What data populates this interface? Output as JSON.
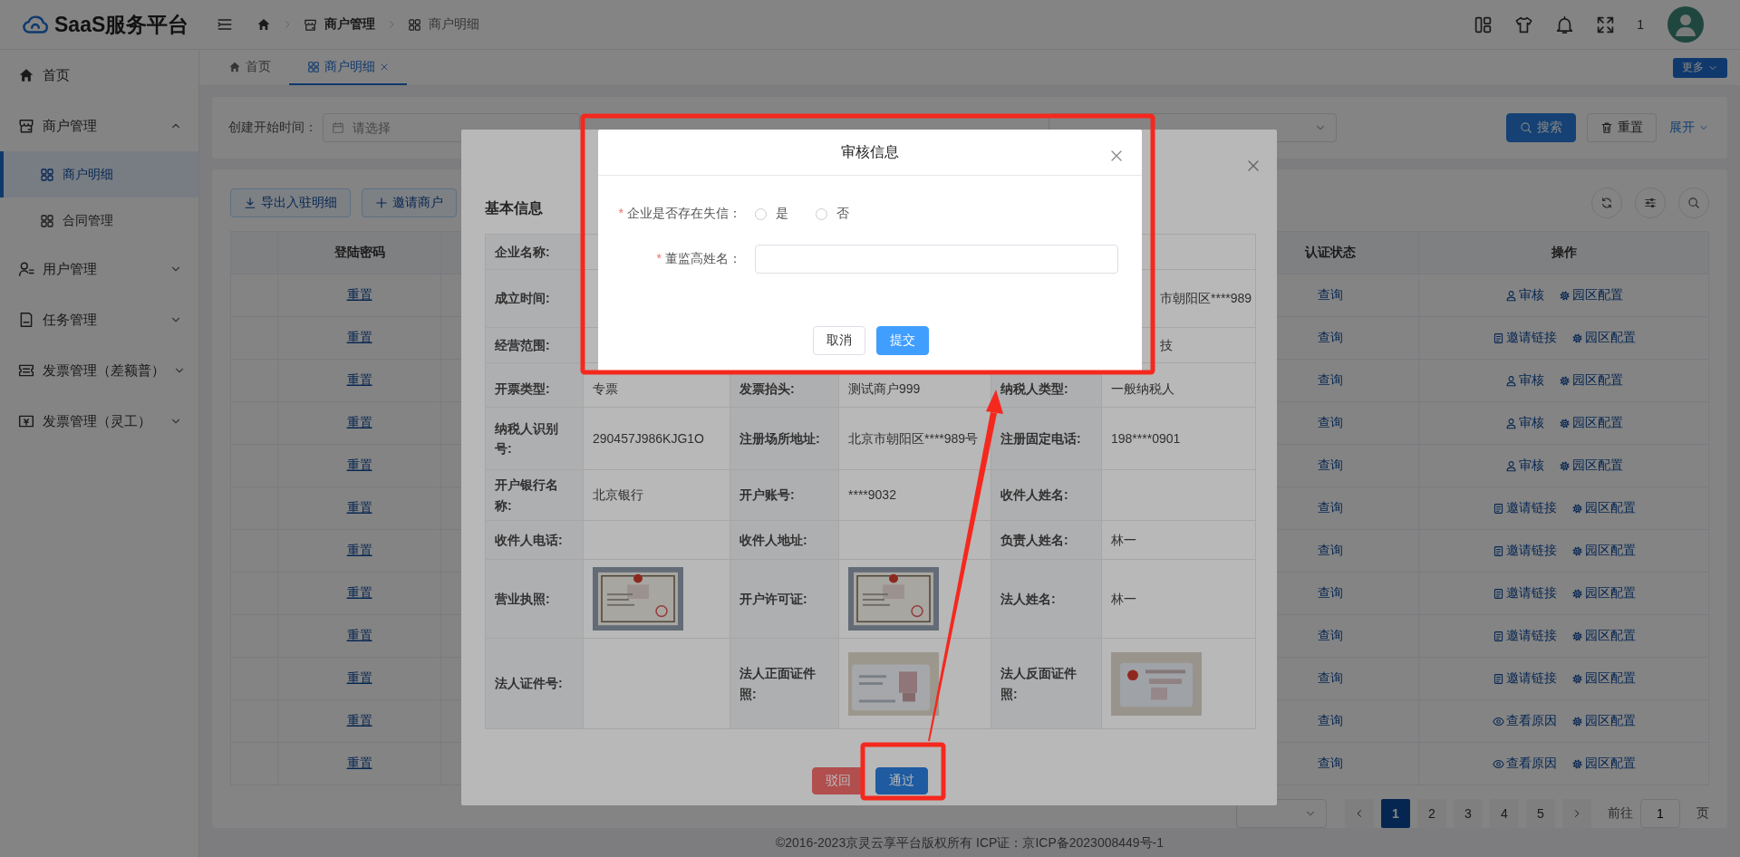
{
  "header": {
    "logo": "SaaS服务平台",
    "breadcrumb": [
      {
        "label": "商户管理"
      },
      {
        "label": "商户明细"
      }
    ],
    "user_badge": "1"
  },
  "sidebar": {
    "items": [
      {
        "label": "首页",
        "selected": false
      },
      {
        "label": "商户管理",
        "selected": false,
        "expanded": true,
        "children": [
          {
            "label": "商户明细",
            "selected": true
          },
          {
            "label": "合同管理",
            "selected": false
          }
        ]
      },
      {
        "label": "用户管理",
        "selected": false,
        "expanded": false
      },
      {
        "label": "任务管理",
        "selected": false,
        "expanded": false
      },
      {
        "label": "发票管理（差额普）",
        "selected": false,
        "expanded": false
      },
      {
        "label": "发票管理（灵工）",
        "selected": false,
        "expanded": false
      }
    ]
  },
  "tabs": [
    {
      "label": "首页",
      "selected": false,
      "closable": false
    },
    {
      "label": "商户明细",
      "selected": true,
      "closable": true
    }
  ],
  "more_button": "更多",
  "filter": {
    "label": "创建开始时间：",
    "placeholder": "请选择",
    "search_button": "搜索",
    "reset_button": "重置",
    "expand_link": "展开"
  },
  "toolbar": [
    "导出入驻明细",
    "邀请商户"
  ],
  "table": {
    "columns": [
      {
        "label": "登陆密码"
      },
      {
        "label": "认证状态"
      },
      {
        "label": "操作"
      }
    ],
    "rows": [
      {
        "password": "重置",
        "status": "查询",
        "actions": [
          {
            "kind": "audit",
            "label": "审核"
          },
          {
            "kind": "settings",
            "label": "园区配置"
          }
        ]
      },
      {
        "password": "重置",
        "status": "查询",
        "actions": [
          {
            "kind": "invite",
            "label": "邀请链接"
          },
          {
            "kind": "settings",
            "label": "园区配置"
          }
        ]
      },
      {
        "password": "重置",
        "status": "查询",
        "actions": [
          {
            "kind": "audit",
            "label": "审核"
          },
          {
            "kind": "settings",
            "label": "园区配置"
          }
        ]
      },
      {
        "password": "重置",
        "status": "查询",
        "actions": [
          {
            "kind": "audit",
            "label": "审核"
          },
          {
            "kind": "settings",
            "label": "园区配置"
          }
        ]
      },
      {
        "password": "重置",
        "status": "查询",
        "actions": [
          {
            "kind": "audit",
            "label": "审核"
          },
          {
            "kind": "settings",
            "label": "园区配置"
          }
        ]
      },
      {
        "password": "重置",
        "status": "查询",
        "actions": [
          {
            "kind": "invite",
            "label": "邀请链接"
          },
          {
            "kind": "settings",
            "label": "园区配置"
          }
        ]
      },
      {
        "password": "重置",
        "status": "查询",
        "actions": [
          {
            "kind": "invite",
            "label": "邀请链接"
          },
          {
            "kind": "settings",
            "label": "园区配置"
          }
        ]
      },
      {
        "password": "重置",
        "status": "查询",
        "actions": [
          {
            "kind": "invite",
            "label": "邀请链接"
          },
          {
            "kind": "settings",
            "label": "园区配置"
          }
        ]
      },
      {
        "password": "重置",
        "status": "查询",
        "actions": [
          {
            "kind": "invite",
            "label": "邀请链接"
          },
          {
            "kind": "settings",
            "label": "园区配置"
          }
        ]
      },
      {
        "password": "重置",
        "status": "查询",
        "actions": [
          {
            "kind": "invite",
            "label": "邀请链接"
          },
          {
            "kind": "settings",
            "label": "园区配置"
          }
        ]
      },
      {
        "password": "重置",
        "status": "查询",
        "actions": [
          {
            "kind": "reason",
            "label": "查看原因"
          },
          {
            "kind": "settings",
            "label": "园区配置"
          }
        ]
      },
      {
        "password": "重置",
        "status": "查询",
        "actions": [
          {
            "kind": "reason",
            "label": "查看原因"
          },
          {
            "kind": "settings",
            "label": "园区配置"
          }
        ]
      }
    ]
  },
  "pagination": {
    "pages": [
      {
        "label": "1",
        "selected": true
      },
      {
        "label": "2",
        "selected": false
      },
      {
        "label": "3",
        "selected": false
      },
      {
        "label": "4",
        "selected": false
      },
      {
        "label": "5",
        "selected": false
      }
    ],
    "goto_label": "前往",
    "goto_value": "1",
    "page_suffix": "页"
  },
  "footer": "©2016-2023京灵云享平台版权所有 ICP证：京ICP备2023008449号-1",
  "detail_modal": {
    "section_title": "基本信息",
    "rows": [
      {
        "cells": [
          {
            "kind": "label",
            "text": "企业名称:"
          },
          {
            "kind": "empty"
          },
          {
            "kind": "empty"
          },
          {
            "kind": "empty"
          },
          {
            "kind": "empty"
          },
          {
            "kind": "empty"
          }
        ]
      },
      {
        "cells": [
          {
            "kind": "label",
            "text": "成立时间:"
          },
          {
            "kind": "empty"
          },
          {
            "kind": "empty"
          },
          {
            "kind": "empty"
          },
          {
            "kind": "empty"
          },
          {
            "kind": "clipped",
            "text": "市朝阳区****989"
          }
        ]
      },
      {
        "cells": [
          {
            "kind": "label",
            "text": "经营范围:"
          },
          {
            "kind": "empty"
          },
          {
            "kind": "empty"
          },
          {
            "kind": "empty"
          },
          {
            "kind": "empty"
          },
          {
            "kind": "clipped",
            "text": "技"
          }
        ]
      },
      {
        "cells": [
          {
            "kind": "label",
            "text": "开票类型:"
          },
          {
            "kind": "value",
            "text": "专票"
          },
          {
            "kind": "label",
            "text": "发票抬头:"
          },
          {
            "kind": "value",
            "text": "测试商户999"
          },
          {
            "kind": "label",
            "text": "纳税人类型:"
          },
          {
            "kind": "value",
            "text": "一般纳税人"
          }
        ]
      },
      {
        "cells": [
          {
            "kind": "label",
            "text": "纳税人识别号:"
          },
          {
            "kind": "value",
            "text": "290457J986KJG1O"
          },
          {
            "kind": "label",
            "text": "注册场所地址:"
          },
          {
            "kind": "value",
            "text": "北京市朝阳区****989号"
          },
          {
            "kind": "label",
            "text": "注册固定电话:"
          },
          {
            "kind": "value",
            "text": "198****0901"
          }
        ]
      },
      {
        "cells": [
          {
            "kind": "label",
            "text": "开户银行名称:"
          },
          {
            "kind": "value",
            "text": "北京银行"
          },
          {
            "kind": "label",
            "text": "开户账号:"
          },
          {
            "kind": "value",
            "text": "****9032"
          },
          {
            "kind": "label",
            "text": "收件人姓名:"
          },
          {
            "kind": "empty"
          }
        ]
      },
      {
        "cells": [
          {
            "kind": "label",
            "text": "收件人电话:"
          },
          {
            "kind": "empty"
          },
          {
            "kind": "label",
            "text": "收件人地址:"
          },
          {
            "kind": "empty"
          },
          {
            "kind": "label",
            "text": "负责人姓名:"
          },
          {
            "kind": "value",
            "text": "林一"
          }
        ]
      },
      {
        "cells": [
          {
            "kind": "label",
            "text": "营业执照:"
          },
          {
            "kind": "picture"
          },
          {
            "kind": "label",
            "text": "开户许可证:"
          },
          {
            "kind": "picture"
          },
          {
            "kind": "label",
            "text": "法人姓名:"
          },
          {
            "kind": "value",
            "text": "林一"
          }
        ]
      },
      {
        "cells": [
          {
            "kind": "label",
            "text": "法人证件号:"
          },
          {
            "kind": "empty"
          },
          {
            "kind": "label",
            "text": "法人正面证件照:"
          },
          {
            "kind": "picture"
          },
          {
            "kind": "label",
            "text": "法人反面证件照:"
          },
          {
            "kind": "picture"
          }
        ]
      }
    ],
    "reject_button": "驳回",
    "approve_button": "通过"
  },
  "audit_modal": {
    "title": "审核信息",
    "fields": [
      {
        "kind": "radio",
        "required_mark": "*",
        "label": "企业是否存在失信：",
        "options": [
          {
            "label": "是",
            "selected": false
          },
          {
            "label": "否",
            "selected": false
          }
        ]
      },
      {
        "kind": "text",
        "required_mark": "*",
        "label": "董监高姓名："
      }
    ],
    "cancel_button": "取消",
    "submit_button": "提交"
  }
}
